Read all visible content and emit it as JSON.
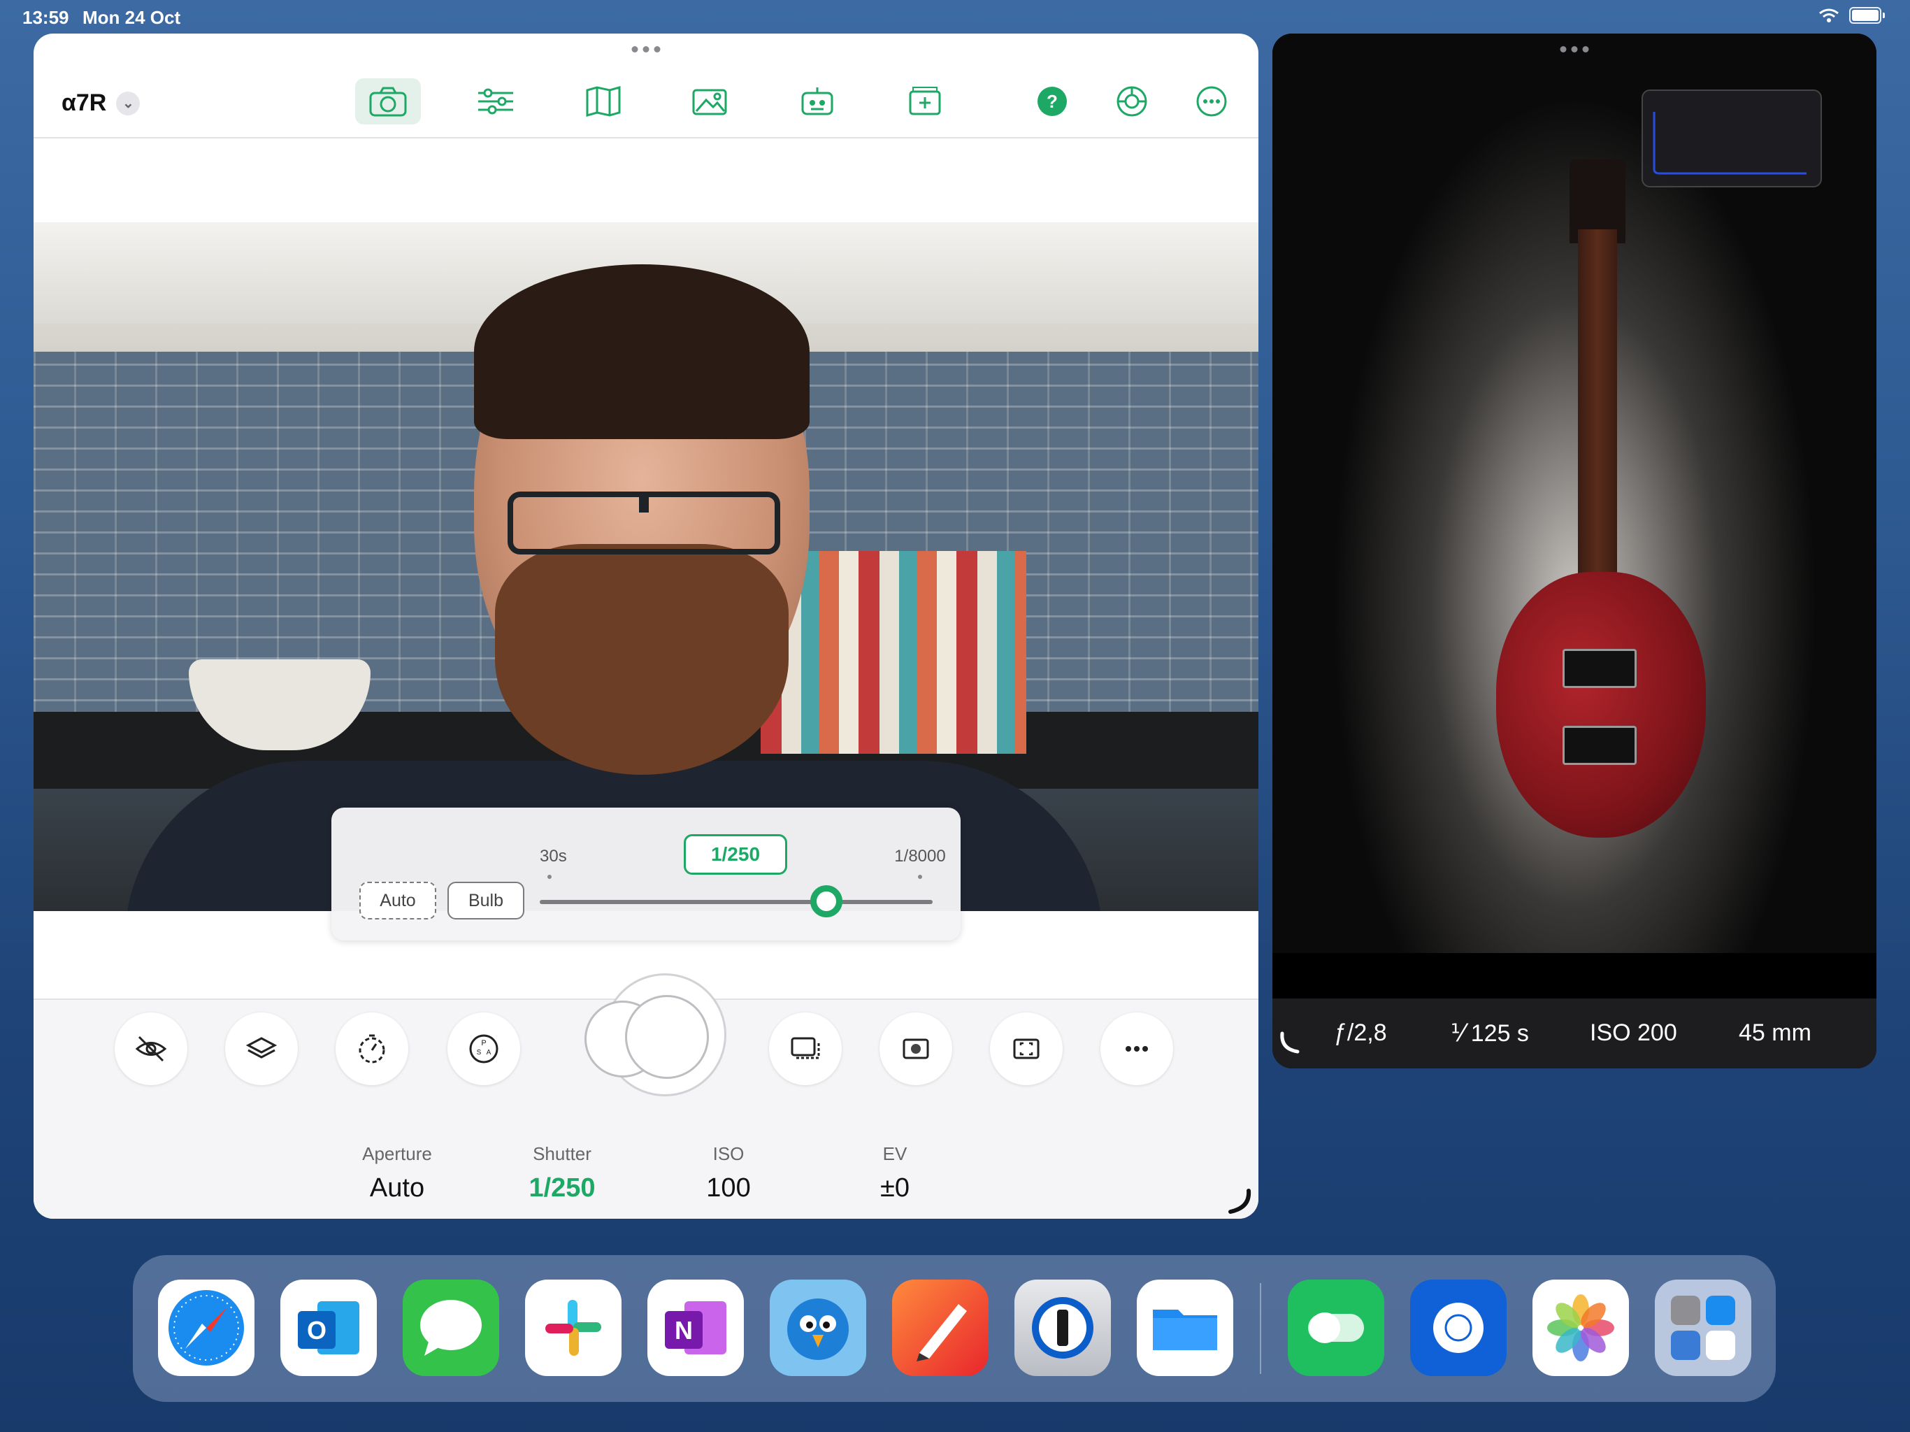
{
  "status_bar": {
    "time": "13:59",
    "date": "Mon 24 Oct"
  },
  "left_window": {
    "camera_name": "α7R",
    "toolbar": {
      "tabs": [
        "camera-tab",
        "adjustments-tab",
        "map-tab",
        "gallery-tab",
        "robot-tab",
        "add-tab"
      ],
      "active": "camera-tab",
      "right_icons": [
        "help-icon",
        "aperture-settings-icon",
        "more-icon"
      ]
    },
    "shutter_panel": {
      "auto_label": "Auto",
      "bulb_label": "Bulb",
      "current_value": "1/250",
      "range_min": "30s",
      "range_max": "1/8000",
      "slider_fraction": 0.73
    },
    "control_buttons": [
      "hide-overlay-icon",
      "layers-icon",
      "timer-icon",
      "drive-mode-icon",
      "display-icon",
      "metering-icon",
      "focus-area-icon",
      "more-options-icon"
    ],
    "exposure": {
      "aperture_label": "Aperture",
      "aperture_value": "Auto",
      "shutter_label": "Shutter",
      "shutter_value": "1/250",
      "iso_label": "ISO",
      "iso_value": "100",
      "ev_label": "EV",
      "ev_value": "±0"
    },
    "accent_color": "#1ea866"
  },
  "right_window": {
    "info": {
      "aperture": "ƒ/2,8",
      "shutter": "⅟ 125 s",
      "iso": "ISO 200",
      "focal_length": "45 mm"
    }
  },
  "dock": {
    "apps": [
      "Safari",
      "Outlook",
      "Messages",
      "Slack",
      "OneNote",
      "Tweetbot",
      "Vectornator",
      "1Password",
      "Files",
      "Halide",
      "Webex",
      "Photos",
      "App Library"
    ]
  }
}
